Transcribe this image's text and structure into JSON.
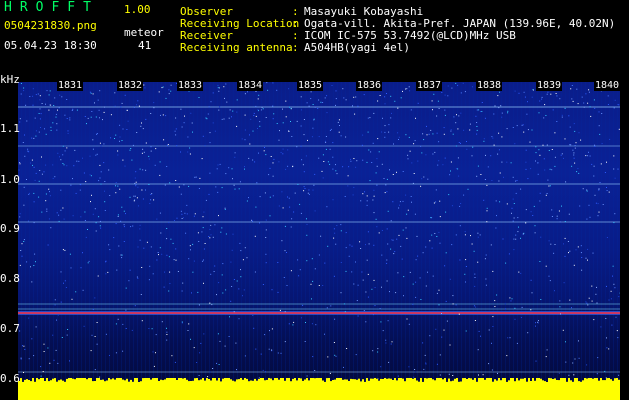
{
  "header": {
    "app_title": "HROFFT",
    "version": "1.00",
    "file_name": "0504231830.png",
    "timestamp": "05.04.23 18:30",
    "meteor_label": "meteor",
    "meteor_count": "41"
  },
  "info": [
    {
      "label": "Observer",
      "value": "Masayuki Kobayashi"
    },
    {
      "label": "Receiving Location",
      "value": "Ogata-vill. Akita-Pref. JAPAN (139.96E, 40.02N)"
    },
    {
      "label": "Receiver",
      "value": "ICOM IC-575 53.7492(@LCD)MHz USB"
    },
    {
      "label": "Receiving antenna",
      "value": "A504HB(yagi 4el)"
    }
  ],
  "axis": {
    "unit": "kHz",
    "y_ticks": [
      "1.1",
      "1.0",
      "0.9",
      "0.8",
      "0.7",
      "0.6"
    ],
    "time_ticks": [
      "1831",
      "1832",
      "1833",
      "1834",
      "1835",
      "1836",
      "1837",
      "1838",
      "1839",
      "1840"
    ]
  },
  "colors": {
    "background": "#000000",
    "header_yellow": "#ffff00",
    "title_green": "#00ff66",
    "signal_line": "#ff3344",
    "carrier_cyan": "#7fe0ff",
    "bottom_bar": "#ffff00"
  }
}
